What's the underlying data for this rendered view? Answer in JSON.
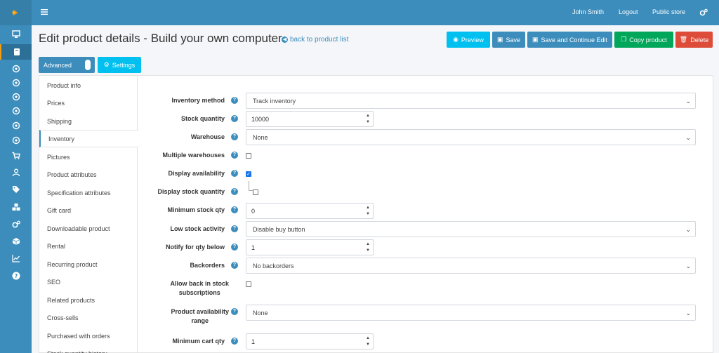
{
  "topbar": {
    "user": "John Smith",
    "logout": "Logout",
    "public_store": "Public store"
  },
  "header": {
    "title": "Edit product details - Build your own computer",
    "back_link": "back to product list"
  },
  "actions": {
    "preview": "Preview",
    "save": "Save",
    "save_continue": "Save and Continue Edit",
    "copy": "Copy product",
    "delete": "Delete"
  },
  "mode": {
    "advanced": "Advanced",
    "settings": "Settings"
  },
  "tabs": [
    "Product info",
    "Prices",
    "Shipping",
    "Inventory",
    "Pictures",
    "Product attributes",
    "Specification attributes",
    "Gift card",
    "Downloadable product",
    "Rental",
    "Recurring product",
    "SEO",
    "Related products",
    "Cross-sells",
    "Purchased with orders",
    "Stock quantity history"
  ],
  "active_tab": "Inventory",
  "form": {
    "inventory_method": {
      "label": "Inventory method",
      "value": "Track inventory"
    },
    "stock_quantity": {
      "label": "Stock quantity",
      "value": "10000"
    },
    "warehouse": {
      "label": "Warehouse",
      "value": "None"
    },
    "multiple_warehouses": {
      "label": "Multiple warehouses",
      "checked": false
    },
    "display_availability": {
      "label": "Display availability",
      "checked": true
    },
    "display_stock_quantity": {
      "label": "Display stock quantity",
      "checked": false
    },
    "minimum_stock_qty": {
      "label": "Minimum stock qty",
      "value": "0"
    },
    "low_stock_activity": {
      "label": "Low stock activity",
      "value": "Disable buy button"
    },
    "notify_qty_below": {
      "label": "Notify for qty below",
      "value": "1"
    },
    "backorders": {
      "label": "Backorders",
      "value": "No backorders"
    },
    "back_in_stock": {
      "label_line1": "Allow back in stock",
      "label_line2": "subscriptions",
      "checked": false
    },
    "availability_range": {
      "label_line1": "Product availability",
      "label_line2": "range",
      "value": "None"
    },
    "minimum_cart_qty": {
      "label": "Minimum cart qty",
      "value": "1"
    }
  },
  "icons": {
    "sidebar": [
      "desktop-icon",
      "book-icon",
      "circle-icon",
      "circle-icon",
      "circle-icon",
      "circle-icon",
      "circle-icon",
      "cart-icon",
      "user-icon",
      "tags-icon",
      "cubes-icon",
      "cogs-icon",
      "cube-icon",
      "chart-icon",
      "question-icon"
    ]
  },
  "colors": {
    "primary": "#3c8dbc",
    "info": "#00c0ef",
    "success": "#00a65a",
    "danger": "#dd4b39"
  }
}
